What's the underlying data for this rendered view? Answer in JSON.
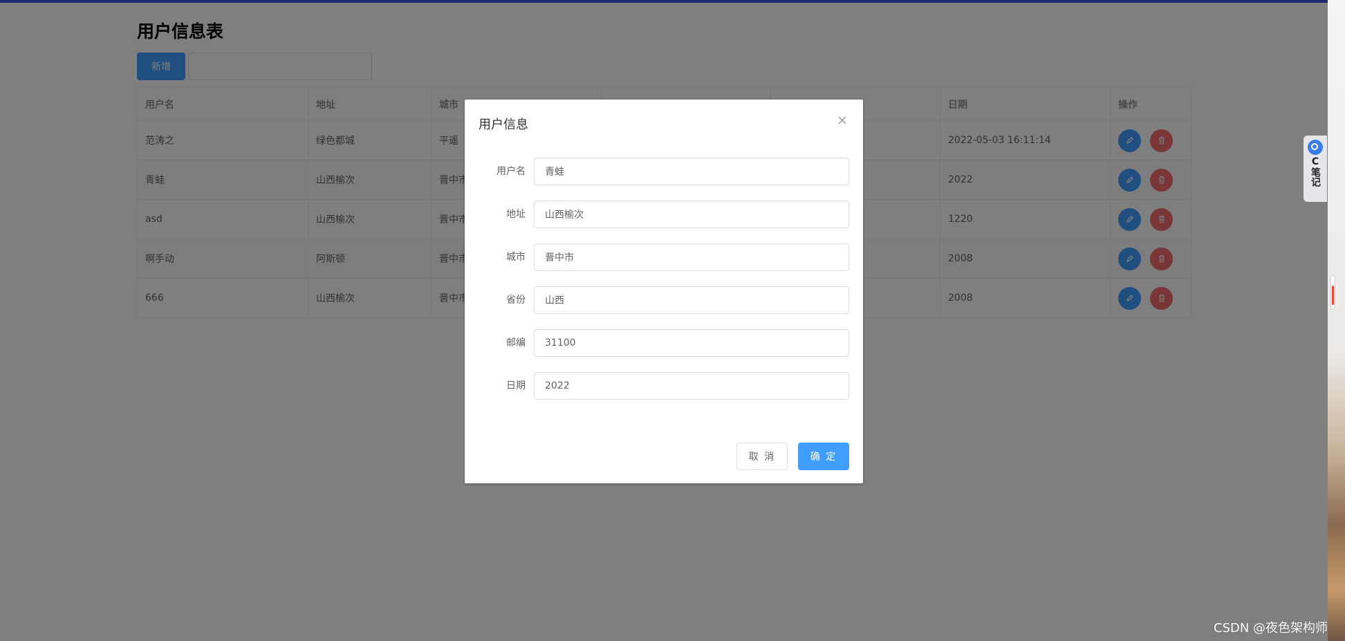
{
  "page": {
    "title": "用户信息表",
    "add_button_label": "新增",
    "search_placeholder": ""
  },
  "table": {
    "columns": [
      "用户名",
      "地址",
      "城市",
      "",
      "",
      "日期",
      "操作"
    ],
    "rows": [
      {
        "username": "范涛之",
        "address": "绿色都城",
        "city": "平遥",
        "date": "2022-05-03 16:11:14"
      },
      {
        "username": "青蛙",
        "address": "山西榆次",
        "city": "晋中市",
        "date": "2022"
      },
      {
        "username": "asd",
        "address": "山西榆次",
        "city": "晋中市",
        "date": "1220"
      },
      {
        "username": "啊手动",
        "address": "阿斯顿",
        "city": "晋中市",
        "date": "2008"
      },
      {
        "username": "666",
        "address": "山西榆次",
        "city": "晋中市",
        "date": "2008"
      }
    ],
    "edit_icon": "edit-icon",
    "delete_icon": "delete-icon"
  },
  "dialog": {
    "title": "用户信息",
    "fields": [
      {
        "label": "用户名",
        "value": "青蛙"
      },
      {
        "label": "地址",
        "value": "山西榆次"
      },
      {
        "label": "城市",
        "value": "晋中市"
      },
      {
        "label": "省份",
        "value": "山西"
      },
      {
        "label": "邮编",
        "value": "31100"
      },
      {
        "label": "日期",
        "value": "2022"
      }
    ],
    "cancel_label": "取 消",
    "confirm_label": "确 定",
    "close_icon": "close-icon"
  },
  "note_widget": {
    "label": "C笔记"
  },
  "watermark": "CSDN @夜色架构师",
  "colors": {
    "primary": "#409eff",
    "danger": "#f56c6c",
    "overlay": "rgba(0,0,0,0.5)"
  }
}
